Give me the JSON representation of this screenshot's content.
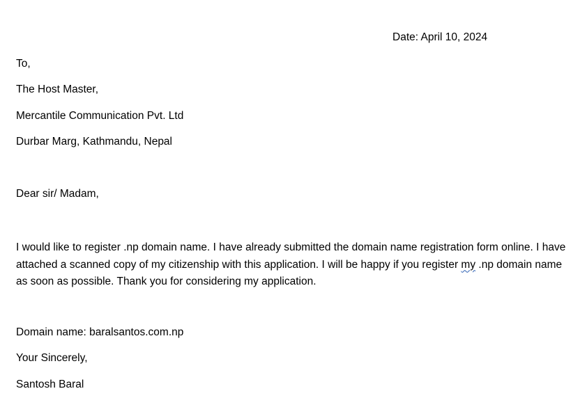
{
  "letter": {
    "date": "Date: April 10, 2024",
    "recipient": {
      "salutation_to": "To,",
      "name": "The Host Master,",
      "company": "Mercantile Communication Pvt. Ltd",
      "address": "Durbar Marg, Kathmandu, Nepal"
    },
    "greeting": "Dear sir/ Madam,",
    "body": {
      "part1": "I would like to register .np domain name. I have already submitted the domain name registration form online. I have attached a scanned copy of my citizenship with this application. I will be happy if you register ",
      "flagged_word": "my",
      "part2": " .np domain name as soon as possible. Thank you for considering my application."
    },
    "domain_line": "Domain name: baralsantos.com.np",
    "closing": "Your Sincerely,",
    "signature": "Santosh Baral"
  },
  "colors": {
    "text": "#000000",
    "spellcheck_underline": "#2b5fb3",
    "background": "#ffffff"
  }
}
